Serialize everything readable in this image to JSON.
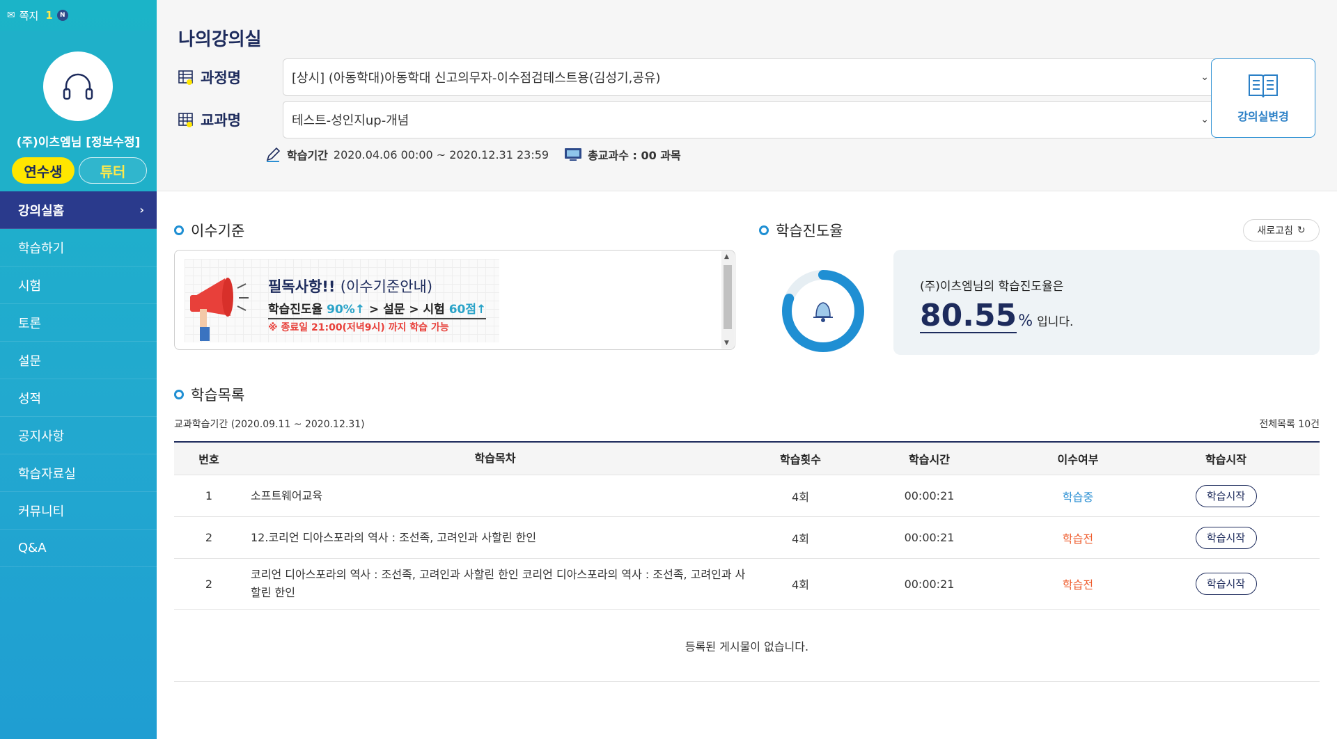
{
  "sidebar": {
    "message_label": "쪽지",
    "message_count": "1",
    "new_badge": "N",
    "username": "(주)이츠엠님 [정보수정]",
    "role_student": "연수생",
    "role_tutor": "튜터",
    "nav": [
      {
        "label": "강의실홈"
      },
      {
        "label": "학습하기"
      },
      {
        "label": "시험"
      },
      {
        "label": "토론"
      },
      {
        "label": "설문"
      },
      {
        "label": "성적"
      },
      {
        "label": "공지사항"
      },
      {
        "label": "학습자료실"
      },
      {
        "label": "커뮤니티"
      },
      {
        "label": "Q&A"
      }
    ]
  },
  "header": {
    "title": "나의강의실",
    "course_label": "과정명",
    "course_value": "[상시] (아동학대)아동학대 신고의무자-이수점검테스트용(김성기,공유)",
    "subject_label": "교과명",
    "subject_value": "테스트-성인지up-개념",
    "change_room_label": "강의실변경",
    "period_label": "학습기간",
    "period_value": "2020.04.06 00:00 ~ 2020.12.31 23:59",
    "total_label": "총교과수 : 00 과목"
  },
  "criteria": {
    "title": "이수기준",
    "banner_line1_bold": "필독사항!!",
    "banner_line1_rest": "(이수기준안내)",
    "banner_line2_a": "학습진도율 ",
    "banner_line2_b": "90%↑",
    "banner_line2_c": " > 설문 > 시험 ",
    "banner_line2_d": "60점↑",
    "banner_line3": "※ 종료일 21:00(저녁9시) 까지 학습 가능"
  },
  "progress": {
    "title": "학습진도율",
    "refresh_label": "새로고침",
    "caption": "(주)이츠엠님의 학습진도율은",
    "value": "80.55",
    "percent_sign": "%",
    "tail": "입니다.",
    "fraction": 0.8055,
    "accent": "#1f8fd3"
  },
  "list": {
    "title": "학습목록",
    "period": "교과학습기간 (2020.09.11 ~ 2020.12.31)",
    "total": "전체목록 10건",
    "headers": {
      "no": "번호",
      "title": "학습목차",
      "count": "학습횟수",
      "time": "학습시간",
      "done": "이수여부",
      "start": "학습시작"
    },
    "rows": [
      {
        "no": "1",
        "title": "소프트웨어교육",
        "count": "4회",
        "time": "00:00:21",
        "done": "학습중",
        "start": "학습시작"
      },
      {
        "no": "2",
        "title": "12.코리언 디아스포라의 역사 : 조선족, 고려인과 사할린 한인",
        "count": "4회",
        "time": "00:00:21",
        "done": "학습전",
        "start": "학습시작"
      },
      {
        "no": "2",
        "title": "코리언 디아스포라의 역사 : 조선족, 고려인과 사할린 한인 코리언 디아스포라의 역사 : 조선족, 고려인과 사할린 한인",
        "count": "4회",
        "time": "00:00:21",
        "done": "학습전",
        "start": "학습시작"
      }
    ],
    "empty_text": "등록된 게시물이 없습니다."
  }
}
